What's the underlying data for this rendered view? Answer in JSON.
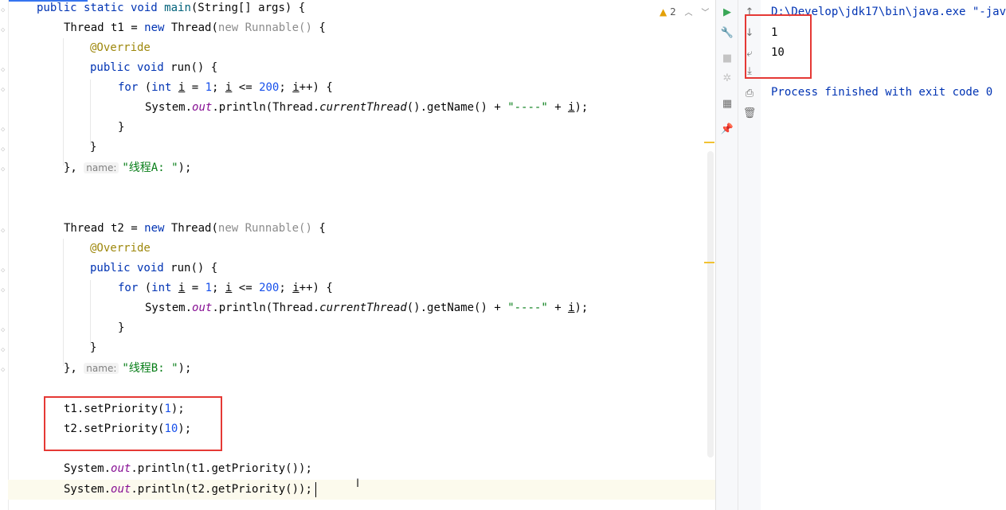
{
  "editor": {
    "lines": [
      "public static void main(String[] args) {",
      "Thread t1 = new Thread(new Runnable() {",
      "@Override",
      "public void run() {",
      "for (int i = 1; i <= 200; i++) {",
      "System.out.println(Thread.currentThread().getName() + \"----\" + i);",
      "}",
      "}",
      "}, name: \"线程A: \");",
      "Thread t2 = new Thread(new Runnable() {",
      "@Override",
      "public void run() {",
      "for (int i = 1; i <= 200; i++) {",
      "System.out.println(Thread.currentThread().getName() + \"----\" + i);",
      "}",
      "}",
      "}, name: \"线程B: \");",
      "t1.setPriority(1);",
      "t2.setPriority(10);",
      "System.out.println(t1.getPriority());",
      "System.out.println(t2.getPriority());"
    ],
    "inspection": {
      "warning_count": "2",
      "icon": "warning-triangle-icon"
    }
  },
  "run_toolbar": {
    "icons": [
      "rerun-icon",
      "wrench-icon",
      "stop-icon",
      "debug-settings-icon",
      "layout-icon",
      "pin-icon"
    ]
  },
  "console_toolbar": {
    "icons": [
      "scroll-up-icon",
      "scroll-down-icon",
      "soft-wrap-icon",
      "scroll-to-end-icon",
      "print-icon",
      "trash-icon"
    ]
  },
  "console": {
    "command": "D:\\Develop\\jdk17\\bin\\java.exe \"-jav",
    "output": [
      "1",
      "10"
    ],
    "finished": "Process finished with exit code 0"
  },
  "colors": {
    "highlight_box": "#e53935",
    "keyword": "#0033b3",
    "string": "#067d17",
    "number": "#1750eb",
    "annotation": "#9e880d"
  }
}
